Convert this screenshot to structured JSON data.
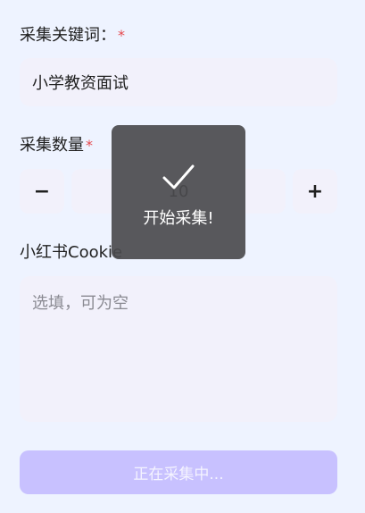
{
  "keyword": {
    "label": "采集关键词：",
    "required_mark": "*",
    "value": "小学教资面试"
  },
  "count": {
    "label": "采集数量",
    "required_mark": "*",
    "decrement_label": "−",
    "increment_label": "+",
    "value": "10"
  },
  "cookie": {
    "label": "小红书Cookie",
    "placeholder": "选填，可为空"
  },
  "submit": {
    "label": "正在采集中..."
  },
  "toast": {
    "icon": "checkmark-icon",
    "message": "开始采集!"
  },
  "colors": {
    "background": "#eef3ff",
    "field": "#f2f1fb",
    "required": "#e5484d",
    "submit_disabled": "#c8c1ff",
    "toast_bg": "#4b4b4e"
  }
}
